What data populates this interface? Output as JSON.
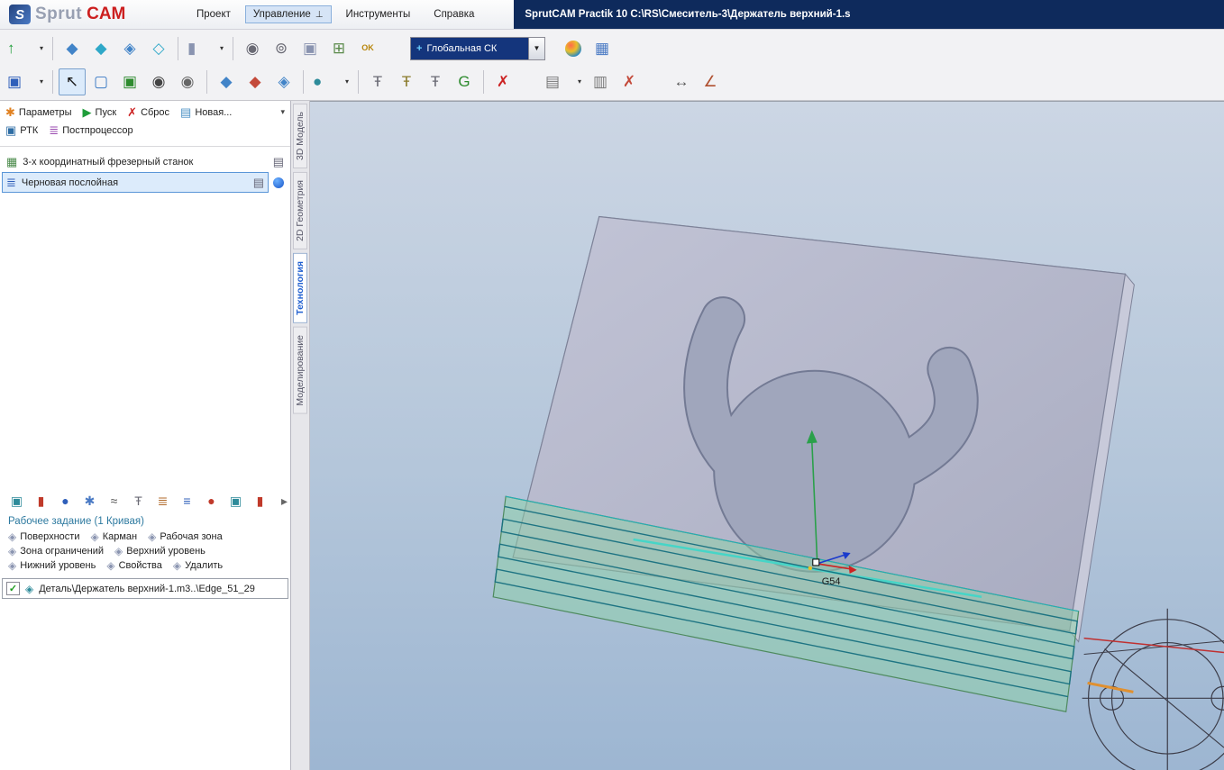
{
  "window": {
    "logo_mark": "S",
    "logo_sprut": "Sprut",
    "logo_cam": "CAM",
    "title": "SprutCAM Practik 10  C:\\RS\\Смеситель-3\\Держатель верхний-1.s"
  },
  "menu": {
    "items": [
      "Проект",
      "Управление",
      "Инструменты",
      "Справка"
    ],
    "active": "Управление"
  },
  "toolbar": {
    "cs_combo": "Глобальная СК"
  },
  "toolbars": {
    "row1a": [
      {
        "n": "load-model-button",
        "g": "↑",
        "c": "#1f9d3a",
        "caret": true
      },
      {
        "sep": true
      },
      {
        "n": "surface-icon-1",
        "g": "◆",
        "c": "#4284c8"
      },
      {
        "n": "surface-icon-2",
        "g": "◆",
        "c": "#2fa8c8"
      },
      {
        "n": "surface-icon-3",
        "g": "◈",
        "c": "#4284c8"
      },
      {
        "n": "surface-icon-4",
        "g": "◇",
        "c": "#2fa8c8"
      },
      {
        "sep": true
      },
      {
        "n": "solid-cylinder-icon",
        "g": "▮",
        "c": "#8a94b0",
        "caret": true
      },
      {
        "sep": true
      },
      {
        "n": "rotary-tool-icon",
        "g": "◉",
        "c": "#6a6a74"
      },
      {
        "n": "spindle-icon",
        "g": "⊚",
        "c": "#6a6a74"
      },
      {
        "n": "stock-box-icon",
        "g": "▣",
        "c": "#8a94b0"
      },
      {
        "n": "fixture-icon",
        "g": "⊞",
        "c": "#5a8a4a"
      },
      {
        "n": "ok-machine-icon",
        "g": "OK",
        "c": "#b8860b",
        "small": true
      },
      {
        "gap": 26
      }
    ],
    "row1b": [
      {
        "gap": 10
      },
      {
        "n": "shaded-view-icon",
        "cls": "i-sphere"
      },
      {
        "n": "machine-simulation-icon",
        "g": "▦",
        "c": "#4a7ac4"
      }
    ],
    "row2": [
      {
        "n": "save-button",
        "g": "▣",
        "c": "#2f5fba",
        "caret": true
      },
      {
        "sep": true
      },
      {
        "n": "select-cursor-button",
        "g": "↖",
        "c": "#1a1a1a",
        "pressed": true
      },
      {
        "n": "marquee-select-icon",
        "g": "▢",
        "c": "#3a7ac4"
      },
      {
        "n": "fit-view-icon",
        "g": "▣",
        "c": "#2e8b2e"
      },
      {
        "n": "snapshot-camera-icon",
        "g": "◉",
        "c": "#444"
      },
      {
        "n": "snapshot-add-icon",
        "g": "◉",
        "c": "#666"
      },
      {
        "sep": true
      },
      {
        "n": "surface-icon-5",
        "g": "◆",
        "c": "#4284c8"
      },
      {
        "n": "surface-icon-6",
        "g": "◆",
        "c": "#c44a3a"
      },
      {
        "n": "surface-icon-7",
        "g": "◈",
        "c": "#4284c8"
      },
      {
        "sep": true
      },
      {
        "n": "solid-sphere-icon",
        "g": "●",
        "c": "#2e8b9a",
        "caret": true
      },
      {
        "sep": true
      },
      {
        "n": "tool-library-icon",
        "g": "Ŧ",
        "c": "#6a6a74"
      },
      {
        "n": "tool-holder-icon",
        "g": "Ŧ",
        "c": "#8a7a2a"
      },
      {
        "n": "tool-params-icon",
        "g": "Ŧ",
        "c": "#6a6a74"
      },
      {
        "n": "gcode-icon",
        "g": "G",
        "c": "#2e8b2e"
      },
      {
        "sep": true
      },
      {
        "n": "skip-toolpath-icon",
        "g": "✗",
        "c": "#cc2222"
      },
      {
        "gap": 24
      },
      {
        "n": "export-doc-button",
        "g": "▤",
        "c": "#777",
        "caret": true
      },
      {
        "n": "report-icon",
        "g": "▥",
        "c": "#777"
      },
      {
        "n": "remove-doc-icon",
        "g": "✗",
        "c": "#c44a3a"
      },
      {
        "gap": 24
      },
      {
        "n": "measure-caliper-icon",
        "g": "↔",
        "c": "#555"
      },
      {
        "n": "axes-icon",
        "g": "∠",
        "c": "#b05030"
      }
    ],
    "job_tools": [
      {
        "n": "workpiece-icon",
        "g": "▣",
        "c": "#2e8b9a"
      },
      {
        "n": "stock-icon",
        "g": "▮",
        "c": "#c03a2a"
      },
      {
        "n": "sphere-icon",
        "g": "●",
        "c": "#2f5fba"
      },
      {
        "n": "settings-gear-icon",
        "g": "✱",
        "c": "#4a7ac4"
      },
      {
        "n": "curve-icon",
        "g": "≈",
        "c": "#555"
      },
      {
        "n": "tool-icon",
        "g": "Ŧ",
        "c": "#6a6a74"
      },
      {
        "n": "levels-icon",
        "g": "≣",
        "c": "#b06a2a"
      },
      {
        "n": "list-icon",
        "g": "≡",
        "c": "#2f5fba"
      },
      {
        "n": "feed-icon",
        "g": "●",
        "c": "#c03a2a"
      },
      {
        "n": "copy-icon",
        "g": "▣",
        "c": "#2e8b9a"
      },
      {
        "n": "holder-icon",
        "g": "▮",
        "c": "#c03a2a"
      },
      {
        "n": "more-arrow",
        "g": "▸",
        "c": "#666"
      }
    ]
  },
  "left_panel": {
    "controls": {
      "parameters": "Параметры",
      "start": "Пуск",
      "reset": "Сброс",
      "new": "Новая...",
      "ptk": "РТК",
      "postprocessor": "Постпроцессор"
    },
    "tree": [
      {
        "label": "3-х координатный фрезерный станок"
      },
      {
        "label": "Черновая послойная",
        "selected": true
      }
    ],
    "job": {
      "title": "Рабочее задание  (1 Кривая)",
      "buttons": [
        "Поверхности",
        "Карман",
        "Рабочая зона",
        "Зона ограничений",
        "Верхний уровень",
        "Нижний уровень",
        "Свойства",
        "Удалить"
      ],
      "item": "Деталь\\Держатель верхний-1.m3..\\Edge_51_29"
    }
  },
  "side_tabs": {
    "items": [
      "3D Модель",
      "2D Геометрия",
      "Технология",
      "Моделирование"
    ],
    "active": "Технология"
  },
  "viewport": {
    "axis_label": "G54",
    "background_top": "#ccd6e4",
    "background_bottom": "#9db6d2",
    "stock_color": "#8cd2a5",
    "toolpath_color": "#17707f",
    "highlight_edge_color": "#00d8e8"
  }
}
